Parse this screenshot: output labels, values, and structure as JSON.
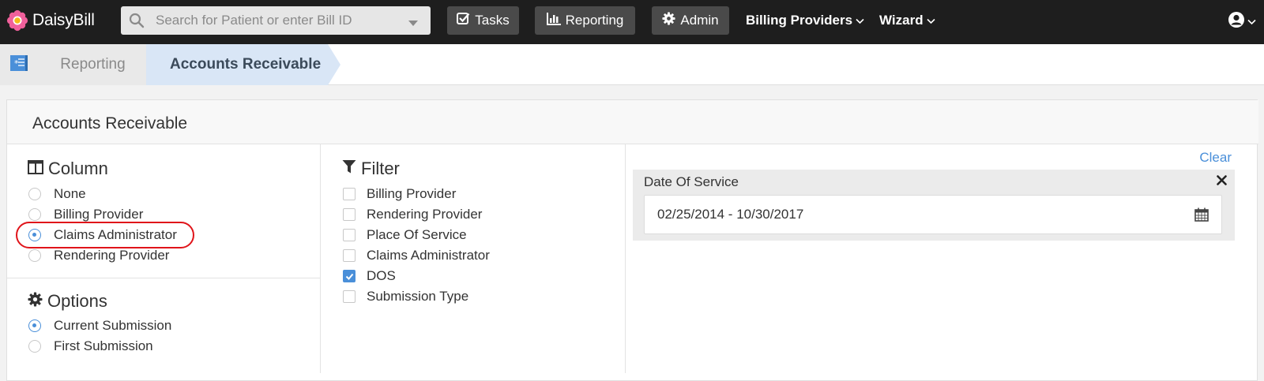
{
  "nav": {
    "brand": "DaisyBill",
    "search_placeholder": "Search for Patient or enter Bill ID",
    "buttons": {
      "tasks": "Tasks",
      "reporting": "Reporting",
      "admin": "Admin"
    },
    "links": {
      "billing_providers": "Billing Providers",
      "wizard": "Wizard"
    }
  },
  "breadcrumb": {
    "items": [
      "Reporting",
      "Accounts Receivable"
    ]
  },
  "panel": {
    "title": "Accounts Receivable",
    "column": {
      "heading": "Column",
      "options": [
        "None",
        "Billing Provider",
        "Claims Administrator",
        "Rendering Provider"
      ],
      "selected": "Claims Administrator"
    },
    "options": {
      "heading": "Options",
      "options": [
        "Current Submission",
        "First Submission"
      ],
      "selected": "Current Submission"
    },
    "filter": {
      "heading": "Filter",
      "options": [
        "Billing Provider",
        "Rendering Provider",
        "Place Of Service",
        "Claims Administrator",
        "DOS",
        "Submission Type"
      ],
      "checked": [
        "DOS"
      ]
    },
    "active_filters": {
      "clear_label": "Clear",
      "date_of_service": {
        "label": "Date Of Service",
        "value": "02/25/2014 - 10/30/2017"
      }
    }
  },
  "colors": {
    "nav_bg": "#1e1e1e",
    "accent": "#4a8fd9",
    "highlight": "#e0141a",
    "crumb_active": "#d9e6f6"
  }
}
